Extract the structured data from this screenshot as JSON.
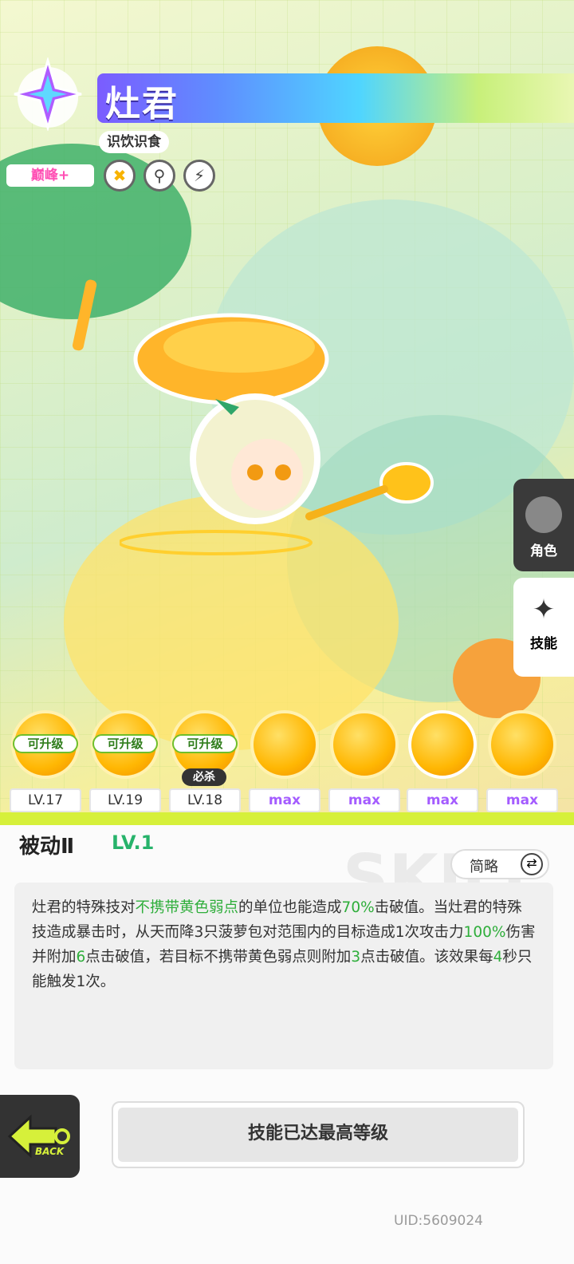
{
  "header": {
    "name": "灶君",
    "subtitle": "识饮识食",
    "rank": "巅峰+"
  },
  "side_nav": {
    "character_label": "角色",
    "skill_label": "技能"
  },
  "skills": [
    {
      "upgrade_label": "可升级",
      "level": "LV.17"
    },
    {
      "upgrade_label": "可升级",
      "level": "LV.19"
    },
    {
      "upgrade_label": "可升级",
      "level": "LV.18",
      "tag": "必杀"
    },
    {
      "level": "max"
    },
    {
      "level": "max"
    },
    {
      "level": "max"
    },
    {
      "level": "max"
    }
  ],
  "detail": {
    "title": "被动Ⅱ",
    "level": "LV.1",
    "toggle_label": "简略",
    "desc": {
      "p1": "灶君的特殊技对",
      "h1": "不携带黄色弱点",
      "p2": "的单位也能造成",
      "h2": "70%",
      "p3": "击破值。当灶君的特殊技造成暴击时，从天而降3只菠萝包对范围内的目标造成1次攻击力",
      "h3": "100%",
      "p4": "伤害并附加",
      "h4": "6",
      "p5": "点击破值，若目标不携带黄色弱点则附加",
      "h5": "3",
      "p6": "点击破值。该效果每",
      "h6": "4",
      "p7": "秒只能触发1次。"
    }
  },
  "footer": {
    "back_label": "BACK",
    "max_button": "技能已达最高等级",
    "uid": "UID:5609024"
  },
  "colors": {
    "accent_green": "#2fae3b",
    "max_purple": "#a45cff",
    "rank_pink": "#ff4fb4"
  }
}
